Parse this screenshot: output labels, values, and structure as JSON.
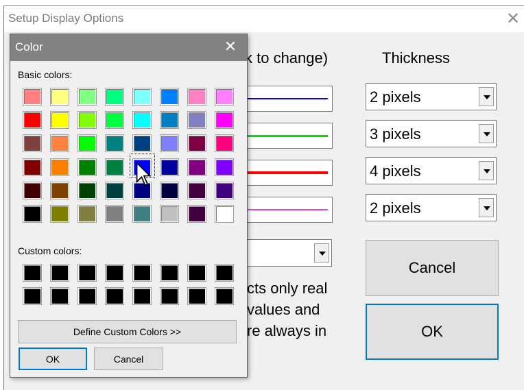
{
  "outer_window": {
    "title": "Setup Display Options",
    "color_header": "k to change)",
    "thickness_header": "Thickness",
    "lines": [
      {
        "color": "#0000e0"
      },
      {
        "color": "#00e000"
      },
      {
        "color": "#ff0000"
      },
      {
        "color": "#e040e0"
      }
    ],
    "thickness_values": [
      "2 pixels",
      "3 pixels",
      "4 pixels",
      "2 pixels"
    ],
    "note_lines": [
      "cts only real",
      " values and",
      "re always in"
    ],
    "cancel_label": "Cancel",
    "ok_label": "OK"
  },
  "color_dialog": {
    "title": "Color",
    "basic_colors_label": "Basic colors:",
    "custom_colors_label": "Custom colors:",
    "basic_colors": [
      [
        "#ff8080",
        "#ffff80",
        "#80ff80",
        "#00ff80",
        "#80ffff",
        "#0080ff",
        "#ff80c0",
        "#ff80ff"
      ],
      [
        "#ff0000",
        "#ffff00",
        "#80ff00",
        "#00ff40",
        "#00ffff",
        "#0080c0",
        "#8080c0",
        "#ff00ff"
      ],
      [
        "#804040",
        "#ff8040",
        "#00ff00",
        "#008080",
        "#004080",
        "#8080ff",
        "#800040",
        "#ff0080"
      ],
      [
        "#800000",
        "#ff8000",
        "#008000",
        "#008040",
        "#0000ff",
        "#0000a0",
        "#800080",
        "#8000ff"
      ],
      [
        "#400000",
        "#804000",
        "#004000",
        "#004040",
        "#000080",
        "#000040",
        "#400040",
        "#400080"
      ],
      [
        "#000000",
        "#808000",
        "#808040",
        "#808080",
        "#408080",
        "#c0c0c0",
        "#400040",
        "#ffffff"
      ]
    ],
    "selected": {
      "row": 3,
      "col": 4
    },
    "custom_colors": [
      [
        "#000000",
        "#000000",
        "#000000",
        "#000000",
        "#000000",
        "#000000",
        "#000000",
        "#000000"
      ],
      [
        "#000000",
        "#000000",
        "#000000",
        "#000000",
        "#000000",
        "#000000",
        "#000000",
        "#000000"
      ]
    ],
    "define_custom_label": "Define Custom Colors >>",
    "ok_label": "OK",
    "cancel_label": "Cancel",
    "close_icon": "close-icon"
  }
}
